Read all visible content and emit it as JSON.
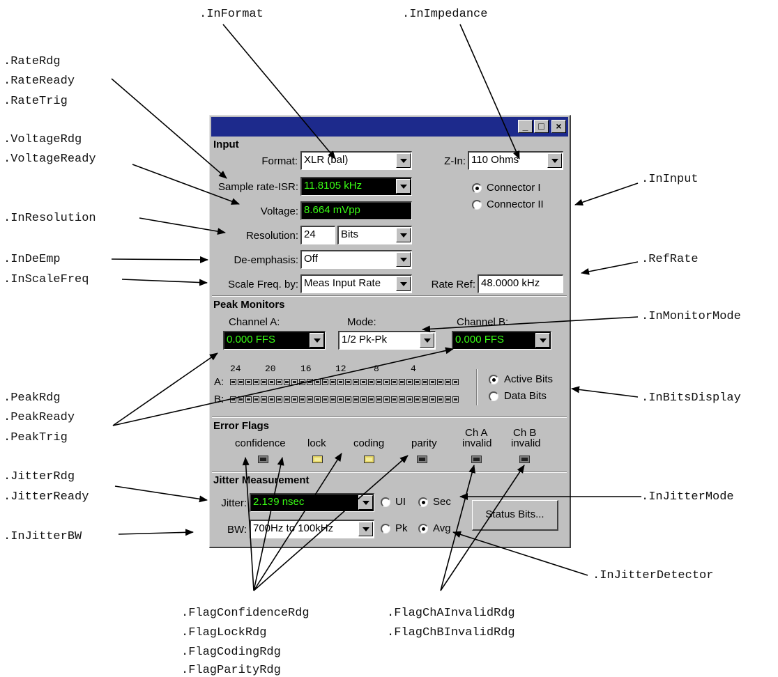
{
  "callouts": {
    "in_format": ".InFormat",
    "in_impedance": ".InImpedance",
    "rate_rdg": ".RateRdg",
    "rate_ready": ".RateReady",
    "rate_trig": ".RateTrig",
    "voltage_rdg": ".VoltageRdg",
    "voltage_ready": ".VoltageReady",
    "in_input": ".InInput",
    "in_resolution": ".InResolution",
    "in_de_emp": ".InDeEmp",
    "ref_rate": ".RefRate",
    "in_scale_freq": ".InScaleFreq",
    "in_monitor_mode": ".InMonitorMode",
    "peak_rdg": ".PeakRdg",
    "peak_ready": ".PeakReady",
    "peak_trig": ".PeakTrig",
    "in_bits_display": ".InBitsDisplay",
    "jitter_rdg": ".JitterRdg",
    "jitter_ready": ".JitterReady",
    "in_jitter_mode": ".InJitterMode",
    "in_jitter_bw": ".InJitterBW",
    "in_jitter_detector": ".InJitterDetector",
    "flag_confidence_rdg": ".FlagConfidenceRdg",
    "flag_lock_rdg": ".FlagLockRdg",
    "flag_coding_rdg": ".FlagCodingRdg",
    "flag_parity_rdg": ".FlagParityRdg",
    "flag_cha_invalid_rdg": ".FlagChAInvalidRdg",
    "flag_chb_invalid_rdg": ".FlagChBInvalidRdg"
  },
  "window": {
    "title": "",
    "minimize": "_",
    "maximize": "□",
    "close": "×"
  },
  "input": {
    "header": "Input",
    "format_label": "Format:",
    "format_value": "XLR (bal)",
    "zin_label": "Z-In:",
    "zin_value": "110 Ohms",
    "sample_rate_label": "Sample rate-ISR:",
    "sample_rate_value": "11.8105 kHz",
    "connector_1": "Connector I",
    "connector_2": "Connector II",
    "connector_selected": "Connector I",
    "voltage_label": "Voltage:",
    "voltage_value": "8.664  mVpp",
    "resolution_label": "Resolution:",
    "resolution_value": "24",
    "resolution_unit": "Bits",
    "de_emphasis_label": "De-emphasis:",
    "de_emphasis_value": "Off",
    "scale_freq_label": "Scale Freq. by:",
    "scale_freq_value": "Meas Input Rate",
    "rate_ref_label": "Rate Ref:",
    "rate_ref_value": "48.0000 kHz"
  },
  "peak": {
    "header": "Peak Monitors",
    "channel_a_label": "Channel A:",
    "channel_a_value": "0.000   FFS",
    "mode_label": "Mode:",
    "mode_value": "1/2 Pk-Pk",
    "channel_b_label": "Channel B:",
    "channel_b_value": "0.000   FFS",
    "bit_numbers": [
      "24",
      "20",
      "16",
      "12",
      "8",
      "4"
    ],
    "row_a": "A:",
    "row_b": "B:",
    "active_bits": "Active Bits",
    "data_bits": "Data Bits",
    "display_selected": "Active Bits"
  },
  "errors": {
    "header": "Error Flags",
    "confidence": "confidence",
    "lock": "lock",
    "coding": "coding",
    "parity": "parity",
    "cha_line1": "Ch A",
    "cha_line2": "invalid",
    "chb_line1": "Ch B",
    "chb_line2": "invalid",
    "lit_flags": [
      "lock",
      "coding"
    ]
  },
  "jitter": {
    "header": "Jitter Measurement",
    "jitter_label": "Jitter:",
    "jitter_value": "2.139   nsec",
    "ui": "UI",
    "sec": "Sec",
    "unit_selected": "Sec",
    "bw_label": "BW:",
    "bw_value": "700Hz to 100kHz",
    "pk": "Pk",
    "avg": "Avg",
    "detector_selected": "Avg",
    "status_bits": "Status Bits..."
  }
}
